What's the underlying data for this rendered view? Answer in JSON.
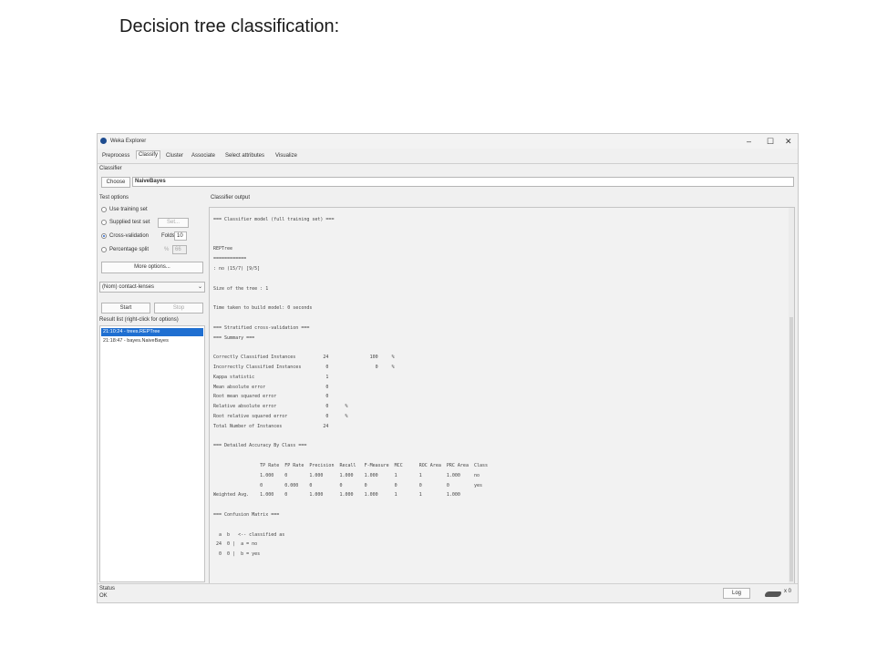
{
  "caption": "Decision tree classification:",
  "window": {
    "title": "Weka Explorer",
    "controls": {
      "minimize": "–",
      "maximize": "☐",
      "close": "✕"
    }
  },
  "tabs": [
    "Preprocess",
    "Classify",
    "Cluster",
    "Associate",
    "Select attributes",
    "Visualize"
  ],
  "classifier": {
    "section_label": "Classifier",
    "choose_label": "Choose",
    "name": "NaiveBayes"
  },
  "test_options": {
    "section_label": "Test options",
    "use_training": "Use training set",
    "supplied_test": "Supplied test set",
    "set_button": "Set...",
    "cross_validation": "Cross-validation",
    "folds_label": "Folds",
    "folds_value": "10",
    "percentage_split": "Percentage split",
    "percent_sign": "%",
    "percent_value": "66",
    "more_options": "More options..."
  },
  "class_select": {
    "value": "(Nom) contact-lenses"
  },
  "start_label": "Start",
  "stop_label": "Stop",
  "result_list": {
    "label": "Result list (right-click for options)",
    "items": [
      "21:10:24 - trees.REPTree",
      "21:18:47 - bayes.NaiveBayes"
    ]
  },
  "output": {
    "label": "Classifier output",
    "lines": [
      "=== Classifier model (full training set) ===",
      "",
      "",
      "REPTree",
      "============",
      ": no (15/7) [9/5]",
      "",
      "Size of the tree : 1",
      "",
      "Time taken to build model: 0 seconds",
      "",
      "=== Stratified cross-validation ===",
      "=== Summary ===",
      "",
      "Correctly Classified Instances          24               100     %",
      "Incorrectly Classified Instances         0                 0     %",
      "Kappa statistic                          1",
      "Mean absolute error                      0",
      "Root mean squared error                  0",
      "Relative absolute error                  0      %",
      "Root relative squared error              0      %",
      "Total Number of Instances               24",
      "",
      "=== Detailed Accuracy By Class ===",
      "",
      "                 TP Rate  FP Rate  Precision  Recall   F-Measure  MCC      ROC Area  PRC Area  Class",
      "                 1.000    0        1.000      1.000    1.000      1        1         1.000     no",
      "                 0        0.000    0          0        0          0        0         0         yes",
      "Weighted Avg.    1.000    0        1.000      1.000    1.000      1        1         1.000",
      "",
      "=== Confusion Matrix ===",
      "",
      "  a  b   <-- classified as",
      " 24  0 |  a = no",
      "  0  0 |  b = yes"
    ]
  },
  "status": {
    "label": "Status",
    "text": "OK",
    "log_button": "Log",
    "x_count": "x 0"
  }
}
